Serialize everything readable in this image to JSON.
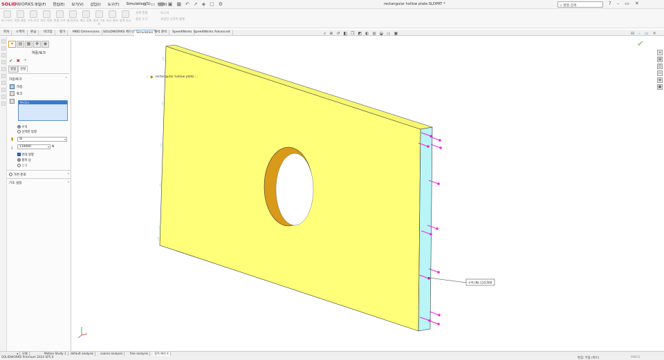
{
  "app": {
    "logo_main": "SOLID",
    "logo_sub": "WORKS",
    "doc_title": "rectangular hollow plate.SLDPRT *",
    "search_placeholder": "명령 검색"
  },
  "menu": [
    "파일(F)",
    "편집(E)",
    "보기(V)",
    "삽입(I)",
    "도구(T)",
    "Simulation(S)",
    "창(W)"
  ],
  "ribbon": {
    "groups": [
      "새 스터디",
      "적용 재질",
      "구속 조건",
      "외부 하중",
      "연결 고려",
      "쉘 관리자",
      "메시 실행",
      "결과 그래프",
      "비교 결과",
      "설계 조사",
      "결과 보기",
      "보고서",
      "결과 비교"
    ],
    "small": [
      "설계 통찰",
      "플롯 도구",
      "보고서",
      "포함된 시각적 플롯"
    ]
  },
  "command_tabs": [
    "피처",
    "스케치",
    "판금",
    "마크업",
    "평가",
    "MBD Dimensions",
    "SOLIDWORKS 애드인",
    "Simulation",
    "해석 준비",
    "SpeedWorks",
    "SpeedWorks Advanced"
  ],
  "active_command_tab": "Simulation",
  "property_manager": {
    "title": "하중/토크",
    "subtabs": [
      "유형",
      "분할"
    ],
    "force_torque_section": "하중/토크",
    "force_label": "하중",
    "torque_label": "토크",
    "selected_face": "면<1>",
    "normal_label": "수직",
    "selected_direction_label": "선택된 방향",
    "units": "SI",
    "force_value": "110000",
    "force_unit": "N",
    "reverse_direction": "반대 방향",
    "per_item": "항목 당",
    "total": "합계",
    "nonuniform": "가변 분포",
    "symbol_settings": "기호 설정"
  },
  "viewport": {
    "tree_flyout": "rectangular hollow plate ...",
    "callout_label": "수직 (N):",
    "callout_value": "110,000"
  },
  "bottom_tabs": [
    "모델",
    "Motion Study 1",
    "default analysis",
    "coarse analysis",
    "fine analysis",
    "정적 해석 4"
  ],
  "active_bottom_tab": "정적 해석 4",
  "status": {
    "left": "SOLIDWORKS Premium 2024 SP5.0",
    "middle": "편집: 부품 (파트)",
    "right": "MMGS"
  },
  "colors": {
    "plate": "#ffff7a",
    "edge_face": "#b9f4f7",
    "hole_inner": "#d99a1a",
    "arrow": "#ee22dd",
    "fixture": "#7ddc7d"
  }
}
